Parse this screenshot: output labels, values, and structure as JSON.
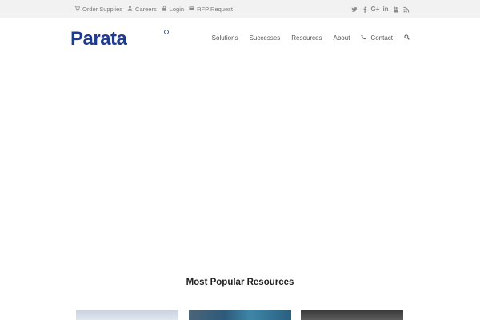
{
  "topbar": {
    "links": [
      {
        "label": "Order Supplies",
        "icon": "cart-icon"
      },
      {
        "label": "Careers",
        "icon": "user-icon"
      },
      {
        "label": "Login",
        "icon": "lock-icon"
      },
      {
        "label": "RFP Request",
        "icon": "inbox-icon"
      }
    ],
    "social": [
      {
        "icon": "twitter-icon"
      },
      {
        "icon": "facebook-icon"
      },
      {
        "icon": "google-plus-icon",
        "text": "G+"
      },
      {
        "icon": "linkedin-icon",
        "text": "in"
      },
      {
        "icon": "youtube-icon"
      },
      {
        "icon": "rss-icon"
      }
    ]
  },
  "header": {
    "logo_text": "Parata",
    "nav": [
      {
        "label": "Solutions"
      },
      {
        "label": "Successes"
      },
      {
        "label": "Resources"
      },
      {
        "label": "About"
      },
      {
        "label": "Contact",
        "icon": "phone-icon"
      }
    ],
    "search_icon": "search-icon"
  },
  "colors": {
    "brand_blue": "#1f3c8c",
    "topbar_bg": "#f2f2f2",
    "text_gray": "#7b7b7b"
  },
  "main": {
    "section_title": "Most Popular Resources"
  }
}
